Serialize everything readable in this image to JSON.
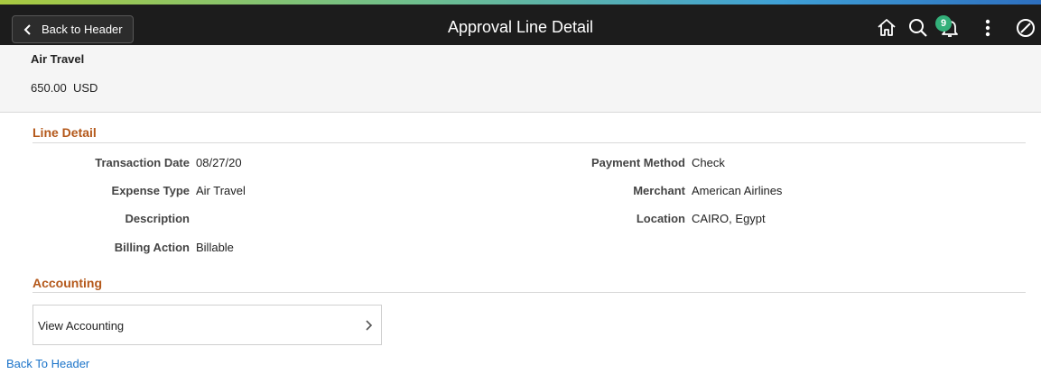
{
  "header": {
    "back_label": "Back to Header",
    "title": "Approval Line Detail",
    "notification_count": "9",
    "icons": [
      "home-icon",
      "search-icon",
      "notifications-icon",
      "actions-menu-icon",
      "navbar-icon"
    ]
  },
  "summary": {
    "expense_type": "Air Travel",
    "amount": "650.00",
    "currency": "USD"
  },
  "line_detail": {
    "title": "Line Detail",
    "left_fields": [
      {
        "label": "Transaction Date",
        "value": "08/27/20"
      },
      {
        "label": "Expense Type",
        "value": "Air Travel"
      },
      {
        "label": "Description",
        "value": ""
      },
      {
        "label": "Billing Action",
        "value": "Billable"
      }
    ],
    "right_fields": [
      {
        "label": "Payment Method",
        "value": "Check"
      },
      {
        "label": "Merchant",
        "value": "American Airlines"
      },
      {
        "label": "Location",
        "value": "CAIRO, Egypt"
      }
    ]
  },
  "accounting": {
    "title": "Accounting",
    "view_label": "View Accounting"
  },
  "footer": {
    "back_link": "Back To Header"
  },
  "colors": {
    "section_title": "#b4581a",
    "link": "#1a73c9",
    "topbar": "#1c1c1c",
    "badge": "#33b07a"
  }
}
